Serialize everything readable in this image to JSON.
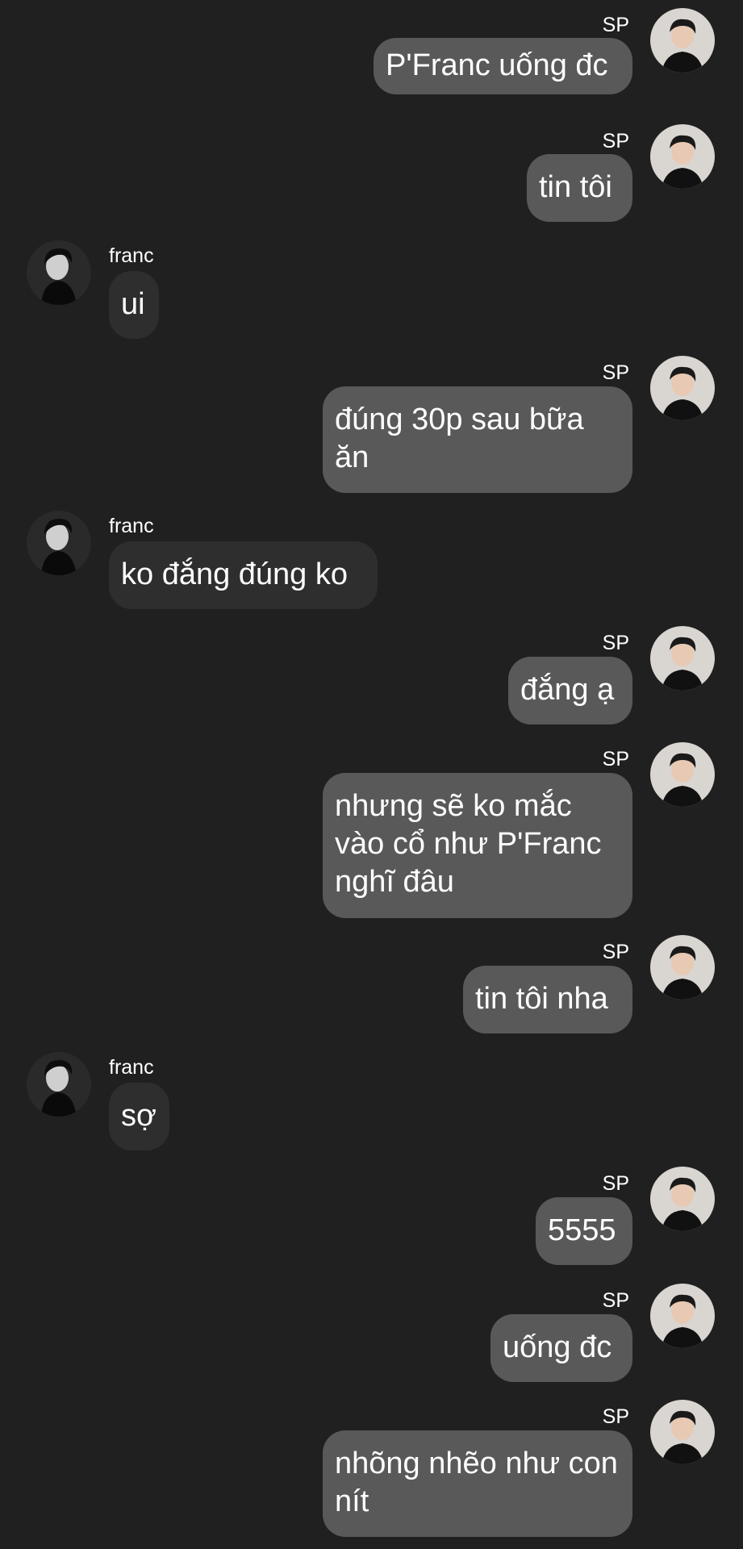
{
  "conversation": {
    "messages": [
      {
        "sender": "SP",
        "direction": "out",
        "text": "P'Franc uống đc"
      },
      {
        "sender": "SP",
        "direction": "out",
        "text": "tin tôi"
      },
      {
        "sender": "franc",
        "direction": "in",
        "text": "ui"
      },
      {
        "sender": "SP",
        "direction": "out",
        "text": "đúng 30p sau bữa ăn"
      },
      {
        "sender": "franc",
        "direction": "in",
        "text": "ko đắng đúng ko"
      },
      {
        "sender": "SP",
        "direction": "out",
        "text": "đắng ạ"
      },
      {
        "sender": "SP",
        "direction": "out",
        "text": "nhưng sẽ ko mắc vào cổ như P'Franc nghĩ đâu"
      },
      {
        "sender": "SP",
        "direction": "out",
        "text": "tin tôi nha"
      },
      {
        "sender": "franc",
        "direction": "in",
        "text": "sợ"
      },
      {
        "sender": "SP",
        "direction": "out",
        "text": "5555"
      },
      {
        "sender": "SP",
        "direction": "out",
        "text": "uống đc"
      },
      {
        "sender": "SP",
        "direction": "out",
        "text": "nhõng nhẽo như con nít"
      }
    ]
  },
  "avatars": {
    "SP": "avatar-sp-photo",
    "franc": "avatar-franc-photo"
  },
  "colors": {
    "background": "#202020",
    "outgoing_bubble": "#595959",
    "incoming_bubble": "#2e2e2e",
    "text": "#ffffff"
  }
}
